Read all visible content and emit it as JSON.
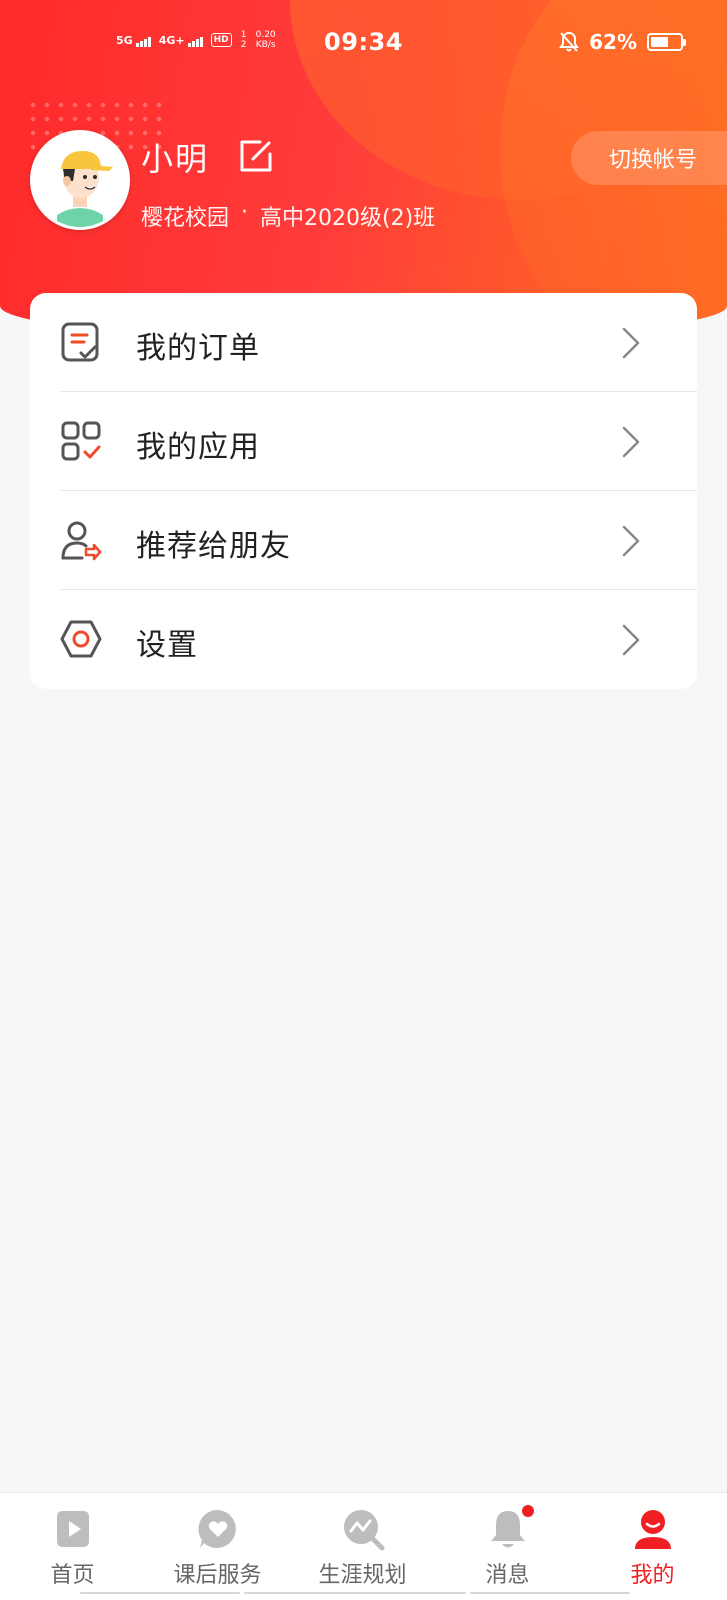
{
  "status_bar": {
    "network1": "5G",
    "network2": "4G+",
    "hd_label": "HD",
    "sim_slots": "1 2",
    "speed_value": "0.20",
    "speed_unit": "KB/s",
    "time": "09:34",
    "battery_percent": "62%",
    "battery_level": 0.62
  },
  "profile": {
    "name": "小明",
    "school": "樱花校园",
    "separator": "·",
    "class_name": "高中2020级(2)班",
    "switch_account": "切换帐号"
  },
  "menu": {
    "items": [
      {
        "label": "我的订单",
        "icon": "order-list-icon"
      },
      {
        "label": "我的应用",
        "icon": "apps-grid-icon"
      },
      {
        "label": "推荐给朋友",
        "icon": "share-user-icon"
      },
      {
        "label": "设置",
        "icon": "settings-hexagon-icon"
      }
    ]
  },
  "tabbar": {
    "tabs": [
      {
        "label": "首页",
        "icon": "play-home-icon",
        "active": false
      },
      {
        "label": "课后服务",
        "icon": "heart-chat-icon",
        "active": false
      },
      {
        "label": "生涯规划",
        "icon": "career-search-icon",
        "active": false
      },
      {
        "label": "消息",
        "icon": "bell-icon",
        "active": false,
        "badge": true
      },
      {
        "label": "我的",
        "icon": "user-icon",
        "active": true
      }
    ]
  },
  "colors": {
    "brand_red": "#ef1f23",
    "header_gradient_start": "#ff2a2a",
    "header_gradient_end": "#ff6d22",
    "icon_gray": "#555555",
    "icon_accent": "#ef4a2a",
    "inactive_tab": "#b9b9b9"
  }
}
